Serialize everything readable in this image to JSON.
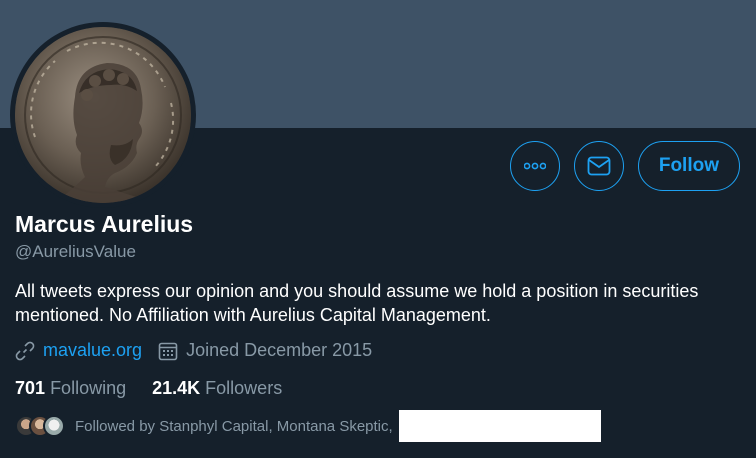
{
  "profile": {
    "name": "Marcus Aurelius",
    "handle": "@AureliusValue",
    "bio": "All tweets express our opinion and you should assume we hold a position in securities mentioned. No Affiliation with Aurelius Capital Management.",
    "website": "mavalue.org",
    "joined": "Joined December 2015"
  },
  "actions": {
    "follow_label": "Follow",
    "more_icon": "more-dots-icon",
    "message_icon": "envelope-icon"
  },
  "stats": {
    "following_count": "701",
    "following_label": "Following",
    "followers_count": "21.4K",
    "followers_label": "Followers"
  },
  "followed_by": {
    "text": "Followed by Stanphyl Capital, Montana Skeptic,"
  },
  "colors": {
    "background": "#15202b",
    "banner": "#3e5266",
    "accent": "#1da1f2",
    "secondary_text": "#8899a6"
  }
}
